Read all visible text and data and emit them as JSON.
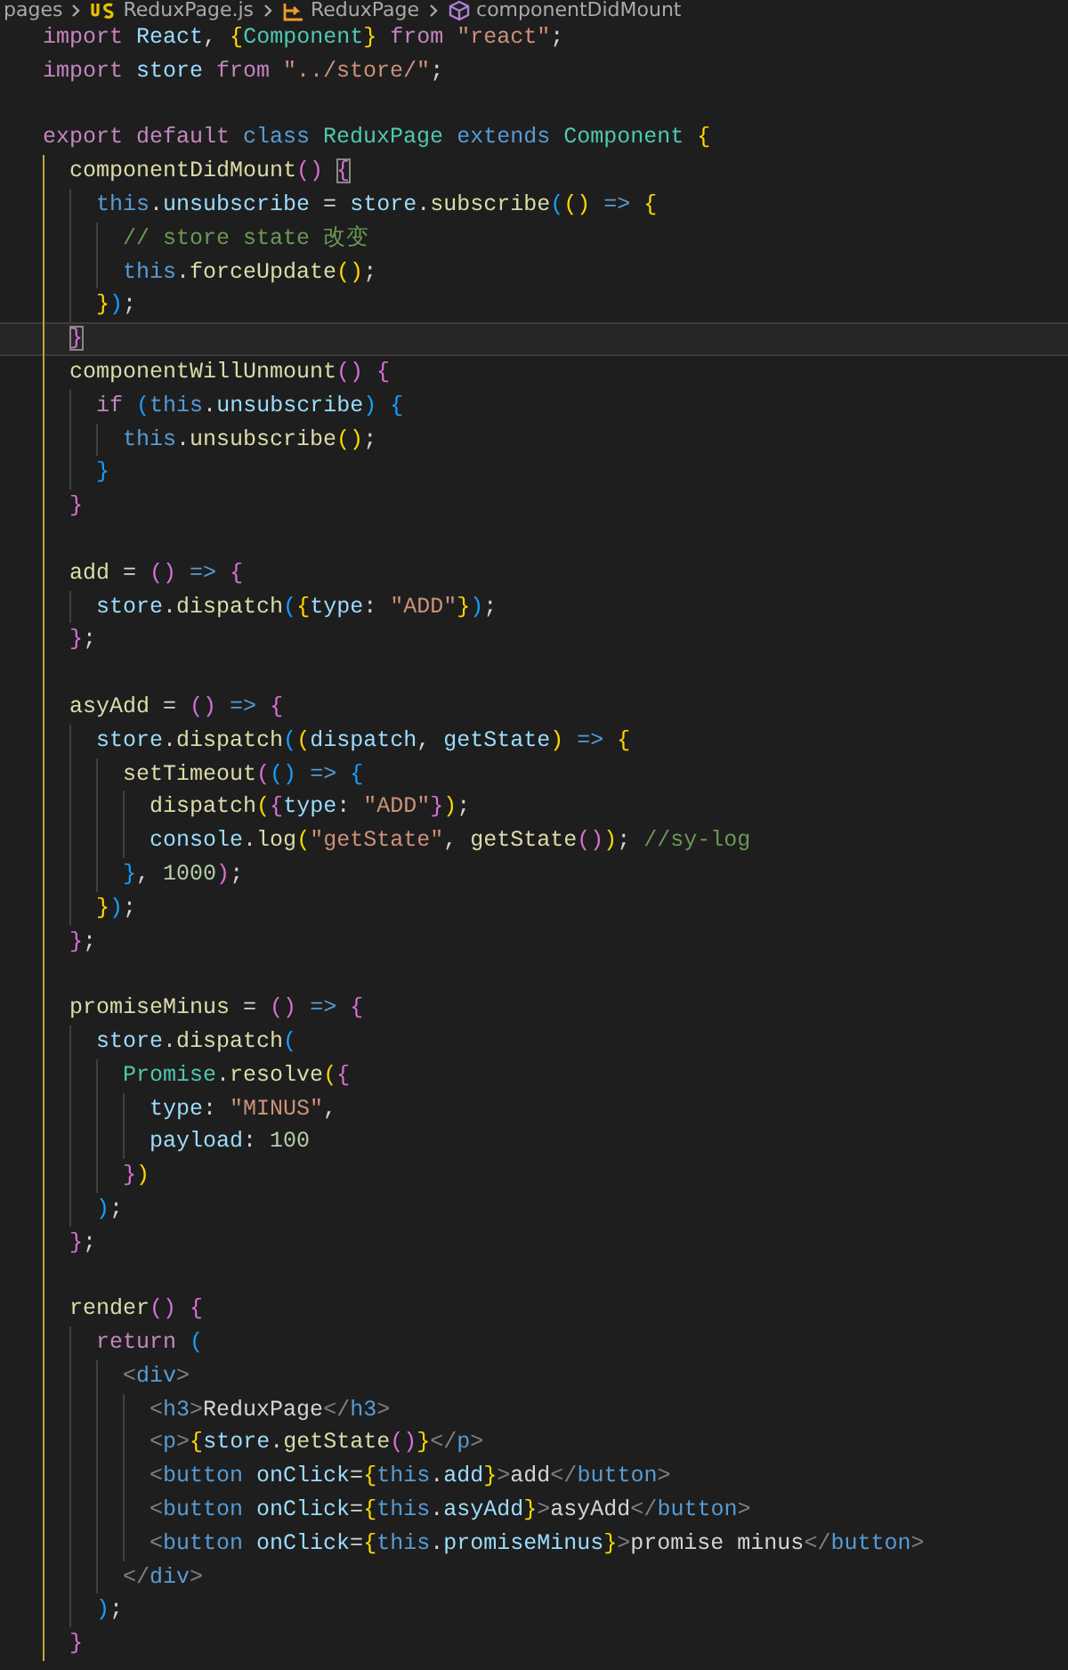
{
  "breadcrumb": [
    {
      "kind": "folder",
      "label": "pages"
    },
    {
      "kind": "file",
      "label": "ReduxPage.js"
    },
    {
      "kind": "component",
      "label": "ReduxPage"
    },
    {
      "kind": "method",
      "label": "componentDidMount"
    }
  ],
  "lines": [
    {
      "kind": "code",
      "current": false,
      "tokens": [
        {
          "kind": "keyword",
          "text": "import "
        },
        {
          "kind": "variable",
          "text": "React"
        },
        {
          "kind": "plain",
          "text": ", "
        },
        {
          "kind": "bracket1",
          "text": "{"
        },
        {
          "kind": "class",
          "text": "Component"
        },
        {
          "kind": "bracket1",
          "text": "}"
        },
        {
          "kind": "keyword",
          "text": " from "
        },
        {
          "kind": "string",
          "text": "\"react\""
        },
        {
          "kind": "plain",
          "text": ";"
        }
      ]
    },
    {
      "kind": "code",
      "current": false,
      "tokens": [
        {
          "kind": "keyword",
          "text": "import "
        },
        {
          "kind": "variable",
          "text": "store "
        },
        {
          "kind": "keyword",
          "text": "from "
        },
        {
          "kind": "string",
          "text": "\"../store/\""
        },
        {
          "kind": "plain",
          "text": ";"
        }
      ]
    },
    {
      "kind": "blank"
    },
    {
      "kind": "code",
      "current": false,
      "tokens": [
        {
          "kind": "keyword",
          "text": "export default "
        },
        {
          "kind": "storage",
          "text": "class "
        },
        {
          "kind": "class",
          "text": "ReduxPage "
        },
        {
          "kind": "storage",
          "text": "extends "
        },
        {
          "kind": "class",
          "text": "Component "
        },
        {
          "kind": "bracket1",
          "text": "{"
        }
      ]
    },
    {
      "kind": "code",
      "current": false,
      "tokens": [
        {
          "kind": "function",
          "text": "  componentDidMount"
        },
        {
          "kind": "bracket2",
          "text": "() "
        },
        {
          "kind": "bracket2",
          "text": "{",
          "matched": true
        }
      ]
    },
    {
      "kind": "code",
      "current": false,
      "tokens": [
        {
          "kind": "storage",
          "text": "    this"
        },
        {
          "kind": "plain",
          "text": "."
        },
        {
          "kind": "variable",
          "text": "unsubscribe"
        },
        {
          "kind": "plain",
          "text": " = "
        },
        {
          "kind": "variable",
          "text": "store"
        },
        {
          "kind": "plain",
          "text": "."
        },
        {
          "kind": "function",
          "text": "subscribe"
        },
        {
          "kind": "bracket3",
          "text": "("
        },
        {
          "kind": "bracket1",
          "text": "() "
        },
        {
          "kind": "storage",
          "text": "=> "
        },
        {
          "kind": "bracket1",
          "text": "{"
        }
      ]
    },
    {
      "kind": "code",
      "current": false,
      "tokens": [
        {
          "kind": "comment",
          "text": "      // store state 改变"
        }
      ]
    },
    {
      "kind": "code",
      "current": false,
      "tokens": [
        {
          "kind": "storage",
          "text": "      this"
        },
        {
          "kind": "plain",
          "text": "."
        },
        {
          "kind": "function",
          "text": "forceUpdate"
        },
        {
          "kind": "bracket1",
          "text": "()"
        },
        {
          "kind": "plain",
          "text": ";"
        }
      ]
    },
    {
      "kind": "code",
      "current": false,
      "tokens": [
        {
          "kind": "bracket1",
          "text": "    }"
        },
        {
          "kind": "bracket3",
          "text": ")"
        },
        {
          "kind": "plain",
          "text": ";"
        }
      ]
    },
    {
      "kind": "code",
      "current": true,
      "tokens": [
        {
          "kind": "bracket2",
          "text": "  }",
          "matched": true
        }
      ]
    },
    {
      "kind": "code",
      "current": false,
      "tokens": [
        {
          "kind": "function",
          "text": "  componentWillUnmount"
        },
        {
          "kind": "bracket2",
          "text": "() {"
        }
      ]
    },
    {
      "kind": "code",
      "current": false,
      "tokens": [
        {
          "kind": "keyword",
          "text": "    if "
        },
        {
          "kind": "bracket3",
          "text": "("
        },
        {
          "kind": "storage",
          "text": "this"
        },
        {
          "kind": "plain",
          "text": "."
        },
        {
          "kind": "variable",
          "text": "unsubscribe"
        },
        {
          "kind": "bracket3",
          "text": ") {"
        }
      ]
    },
    {
      "kind": "code",
      "current": false,
      "tokens": [
        {
          "kind": "storage",
          "text": "      this"
        },
        {
          "kind": "plain",
          "text": "."
        },
        {
          "kind": "function",
          "text": "unsubscribe"
        },
        {
          "kind": "bracket1",
          "text": "()"
        },
        {
          "kind": "plain",
          "text": ";"
        }
      ]
    },
    {
      "kind": "code",
      "current": false,
      "tokens": [
        {
          "kind": "bracket3",
          "text": "    }"
        }
      ]
    },
    {
      "kind": "code",
      "current": false,
      "tokens": [
        {
          "kind": "bracket2",
          "text": "  }"
        }
      ]
    },
    {
      "kind": "blank"
    },
    {
      "kind": "code",
      "current": false,
      "tokens": [
        {
          "kind": "function",
          "text": "  add"
        },
        {
          "kind": "plain",
          "text": " = "
        },
        {
          "kind": "bracket2",
          "text": "() "
        },
        {
          "kind": "storage",
          "text": "=> "
        },
        {
          "kind": "bracket2",
          "text": "{"
        }
      ]
    },
    {
      "kind": "code",
      "current": false,
      "tokens": [
        {
          "kind": "variable",
          "text": "    store"
        },
        {
          "kind": "plain",
          "text": "."
        },
        {
          "kind": "function",
          "text": "dispatch"
        },
        {
          "kind": "bracket3",
          "text": "("
        },
        {
          "kind": "bracket1",
          "text": "{"
        },
        {
          "kind": "variable",
          "text": "type"
        },
        {
          "kind": "plain",
          "text": ": "
        },
        {
          "kind": "string",
          "text": "\"ADD\""
        },
        {
          "kind": "bracket1",
          "text": "}"
        },
        {
          "kind": "bracket3",
          "text": ")"
        },
        {
          "kind": "plain",
          "text": ";"
        }
      ]
    },
    {
      "kind": "code",
      "current": false,
      "tokens": [
        {
          "kind": "bracket2",
          "text": "  }"
        },
        {
          "kind": "plain",
          "text": ";"
        }
      ]
    },
    {
      "kind": "blank"
    },
    {
      "kind": "code",
      "current": false,
      "tokens": [
        {
          "kind": "function",
          "text": "  asyAdd"
        },
        {
          "kind": "plain",
          "text": " = "
        },
        {
          "kind": "bracket2",
          "text": "() "
        },
        {
          "kind": "storage",
          "text": "=> "
        },
        {
          "kind": "bracket2",
          "text": "{"
        }
      ]
    },
    {
      "kind": "code",
      "current": false,
      "tokens": [
        {
          "kind": "variable",
          "text": "    store"
        },
        {
          "kind": "plain",
          "text": "."
        },
        {
          "kind": "function",
          "text": "dispatch"
        },
        {
          "kind": "bracket3",
          "text": "("
        },
        {
          "kind": "bracket1",
          "text": "("
        },
        {
          "kind": "variable",
          "text": "dispatch"
        },
        {
          "kind": "plain",
          "text": ", "
        },
        {
          "kind": "variable",
          "text": "getState"
        },
        {
          "kind": "bracket1",
          "text": ") "
        },
        {
          "kind": "storage",
          "text": "=> "
        },
        {
          "kind": "bracket1",
          "text": "{"
        }
      ]
    },
    {
      "kind": "code",
      "current": false,
      "tokens": [
        {
          "kind": "function",
          "text": "      setTimeout"
        },
        {
          "kind": "bracket2",
          "text": "("
        },
        {
          "kind": "bracket3",
          "text": "() "
        },
        {
          "kind": "storage",
          "text": "=> "
        },
        {
          "kind": "bracket3",
          "text": "{"
        }
      ]
    },
    {
      "kind": "code",
      "current": false,
      "tokens": [
        {
          "kind": "function",
          "text": "        dispatch"
        },
        {
          "kind": "bracket1",
          "text": "("
        },
        {
          "kind": "bracket2",
          "text": "{"
        },
        {
          "kind": "variable",
          "text": "type"
        },
        {
          "kind": "plain",
          "text": ": "
        },
        {
          "kind": "string",
          "text": "\"ADD\""
        },
        {
          "kind": "bracket2",
          "text": "}"
        },
        {
          "kind": "bracket1",
          "text": ")"
        },
        {
          "kind": "plain",
          "text": ";"
        }
      ]
    },
    {
      "kind": "code",
      "current": false,
      "tokens": [
        {
          "kind": "variable",
          "text": "        console"
        },
        {
          "kind": "plain",
          "text": "."
        },
        {
          "kind": "function",
          "text": "log"
        },
        {
          "kind": "bracket1",
          "text": "("
        },
        {
          "kind": "string",
          "text": "\"getState\""
        },
        {
          "kind": "plain",
          "text": ", "
        },
        {
          "kind": "function",
          "text": "getState"
        },
        {
          "kind": "bracket2",
          "text": "()"
        },
        {
          "kind": "bracket1",
          "text": ")"
        },
        {
          "kind": "plain",
          "text": "; "
        },
        {
          "kind": "comment",
          "text": "//sy-log"
        }
      ]
    },
    {
      "kind": "code",
      "current": false,
      "tokens": [
        {
          "kind": "bracket3",
          "text": "      }"
        },
        {
          "kind": "plain",
          "text": ", "
        },
        {
          "kind": "number",
          "text": "1000"
        },
        {
          "kind": "bracket2",
          "text": ")"
        },
        {
          "kind": "plain",
          "text": ";"
        }
      ]
    },
    {
      "kind": "code",
      "current": false,
      "tokens": [
        {
          "kind": "bracket1",
          "text": "    }"
        },
        {
          "kind": "bracket3",
          "text": ")"
        },
        {
          "kind": "plain",
          "text": ";"
        }
      ]
    },
    {
      "kind": "code",
      "current": false,
      "tokens": [
        {
          "kind": "bracket2",
          "text": "  }"
        },
        {
          "kind": "plain",
          "text": ";"
        }
      ]
    },
    {
      "kind": "blank"
    },
    {
      "kind": "code",
      "current": false,
      "tokens": [
        {
          "kind": "function",
          "text": "  promiseMinus"
        },
        {
          "kind": "plain",
          "text": " = "
        },
        {
          "kind": "bracket2",
          "text": "() "
        },
        {
          "kind": "storage",
          "text": "=> "
        },
        {
          "kind": "bracket2",
          "text": "{"
        }
      ]
    },
    {
      "kind": "code",
      "current": false,
      "tokens": [
        {
          "kind": "variable",
          "text": "    store"
        },
        {
          "kind": "plain",
          "text": "."
        },
        {
          "kind": "function",
          "text": "dispatch"
        },
        {
          "kind": "bracket3",
          "text": "("
        }
      ]
    },
    {
      "kind": "code",
      "current": false,
      "tokens": [
        {
          "kind": "class",
          "text": "      Promise"
        },
        {
          "kind": "plain",
          "text": "."
        },
        {
          "kind": "function",
          "text": "resolve"
        },
        {
          "kind": "bracket1",
          "text": "("
        },
        {
          "kind": "bracket2",
          "text": "{"
        }
      ]
    },
    {
      "kind": "code",
      "current": false,
      "tokens": [
        {
          "kind": "variable",
          "text": "        type"
        },
        {
          "kind": "plain",
          "text": ": "
        },
        {
          "kind": "string",
          "text": "\"MINUS\""
        },
        {
          "kind": "plain",
          "text": ","
        }
      ]
    },
    {
      "kind": "code",
      "current": false,
      "tokens": [
        {
          "kind": "variable",
          "text": "        payload"
        },
        {
          "kind": "plain",
          "text": ": "
        },
        {
          "kind": "number",
          "text": "100"
        }
      ]
    },
    {
      "kind": "code",
      "current": false,
      "tokens": [
        {
          "kind": "bracket2",
          "text": "      }"
        },
        {
          "kind": "bracket1",
          "text": ")"
        }
      ]
    },
    {
      "kind": "code",
      "current": false,
      "tokens": [
        {
          "kind": "bracket3",
          "text": "    )"
        },
        {
          "kind": "plain",
          "text": ";"
        }
      ]
    },
    {
      "kind": "code",
      "current": false,
      "tokens": [
        {
          "kind": "bracket2",
          "text": "  }"
        },
        {
          "kind": "plain",
          "text": ";"
        }
      ]
    },
    {
      "kind": "blank"
    },
    {
      "kind": "code",
      "current": false,
      "tokens": [
        {
          "kind": "function",
          "text": "  render"
        },
        {
          "kind": "bracket2",
          "text": "() {"
        }
      ]
    },
    {
      "kind": "code",
      "current": false,
      "tokens": [
        {
          "kind": "keyword",
          "text": "    return "
        },
        {
          "kind": "bracket3",
          "text": "("
        }
      ]
    },
    {
      "kind": "code",
      "current": false,
      "tokens": [
        {
          "kind": "tag",
          "text": "      <"
        },
        {
          "kind": "tagname",
          "text": "div"
        },
        {
          "kind": "tag",
          "text": ">"
        }
      ]
    },
    {
      "kind": "code",
      "current": false,
      "tokens": [
        {
          "kind": "tag",
          "text": "        <"
        },
        {
          "kind": "tagname",
          "text": "h3"
        },
        {
          "kind": "tag",
          "text": ">"
        },
        {
          "kind": "plain",
          "text": "ReduxPage"
        },
        {
          "kind": "tag",
          "text": "</"
        },
        {
          "kind": "tagname",
          "text": "h3"
        },
        {
          "kind": "tag",
          "text": ">"
        }
      ]
    },
    {
      "kind": "code",
      "current": false,
      "tokens": [
        {
          "kind": "tag",
          "text": "        <"
        },
        {
          "kind": "tagname",
          "text": "p"
        },
        {
          "kind": "tag",
          "text": ">"
        },
        {
          "kind": "bracket1",
          "text": "{"
        },
        {
          "kind": "variable",
          "text": "store"
        },
        {
          "kind": "plain",
          "text": "."
        },
        {
          "kind": "function",
          "text": "getState"
        },
        {
          "kind": "bracket2",
          "text": "()"
        },
        {
          "kind": "bracket1",
          "text": "}"
        },
        {
          "kind": "tag",
          "text": "</"
        },
        {
          "kind": "tagname",
          "text": "p"
        },
        {
          "kind": "tag",
          "text": ">"
        }
      ]
    },
    {
      "kind": "code",
      "current": false,
      "tokens": [
        {
          "kind": "tag",
          "text": "        <"
        },
        {
          "kind": "tagname",
          "text": "button "
        },
        {
          "kind": "variable",
          "text": "onClick"
        },
        {
          "kind": "plain",
          "text": "="
        },
        {
          "kind": "bracket1",
          "text": "{"
        },
        {
          "kind": "storage",
          "text": "this"
        },
        {
          "kind": "plain",
          "text": "."
        },
        {
          "kind": "variable",
          "text": "add"
        },
        {
          "kind": "bracket1",
          "text": "}"
        },
        {
          "kind": "tag",
          "text": ">"
        },
        {
          "kind": "plain",
          "text": "add"
        },
        {
          "kind": "tag",
          "text": "</"
        },
        {
          "kind": "tagname",
          "text": "button"
        },
        {
          "kind": "tag",
          "text": ">"
        }
      ]
    },
    {
      "kind": "code",
      "current": false,
      "tokens": [
        {
          "kind": "tag",
          "text": "        <"
        },
        {
          "kind": "tagname",
          "text": "button "
        },
        {
          "kind": "variable",
          "text": "onClick"
        },
        {
          "kind": "plain",
          "text": "="
        },
        {
          "kind": "bracket1",
          "text": "{"
        },
        {
          "kind": "storage",
          "text": "this"
        },
        {
          "kind": "plain",
          "text": "."
        },
        {
          "kind": "variable",
          "text": "asyAdd"
        },
        {
          "kind": "bracket1",
          "text": "}"
        },
        {
          "kind": "tag",
          "text": ">"
        },
        {
          "kind": "plain",
          "text": "asyAdd"
        },
        {
          "kind": "tag",
          "text": "</"
        },
        {
          "kind": "tagname",
          "text": "button"
        },
        {
          "kind": "tag",
          "text": ">"
        }
      ]
    },
    {
      "kind": "code",
      "current": false,
      "tokens": [
        {
          "kind": "tag",
          "text": "        <"
        },
        {
          "kind": "tagname",
          "text": "button "
        },
        {
          "kind": "variable",
          "text": "onClick"
        },
        {
          "kind": "plain",
          "text": "="
        },
        {
          "kind": "bracket1",
          "text": "{"
        },
        {
          "kind": "storage",
          "text": "this"
        },
        {
          "kind": "plain",
          "text": "."
        },
        {
          "kind": "variable",
          "text": "promiseMinus"
        },
        {
          "kind": "bracket1",
          "text": "}"
        },
        {
          "kind": "tag",
          "text": ">"
        },
        {
          "kind": "plain",
          "text": "promise minus"
        },
        {
          "kind": "tag",
          "text": "</"
        },
        {
          "kind": "tagname",
          "text": "button"
        },
        {
          "kind": "tag",
          "text": ">"
        }
      ]
    },
    {
      "kind": "code",
      "current": false,
      "tokens": [
        {
          "kind": "tag",
          "text": "      </"
        },
        {
          "kind": "tagname",
          "text": "div"
        },
        {
          "kind": "tag",
          "text": ">"
        }
      ]
    },
    {
      "kind": "code",
      "current": false,
      "tokens": [
        {
          "kind": "bracket3",
          "text": "    )"
        },
        {
          "kind": "plain",
          "text": ";"
        }
      ]
    },
    {
      "kind": "code",
      "current": false,
      "tokens": [
        {
          "kind": "bracket2",
          "text": "  }"
        }
      ]
    }
  ]
}
